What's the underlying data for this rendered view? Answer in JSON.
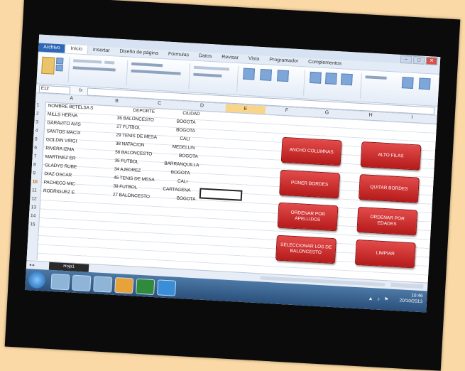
{
  "window": {
    "minimize": "–",
    "maximize": "□",
    "close": "✕"
  },
  "ribbon": {
    "tabs": [
      "Archivo",
      "Inicio",
      "Insertar",
      "Diseño de página",
      "Fórmulas",
      "Datos",
      "Revisar",
      "Vista",
      "Programador",
      "Complementos"
    ]
  },
  "formula_bar": {
    "name_box": "E12",
    "fx": "fx",
    "content": ""
  },
  "sheet": {
    "columns": [
      "A",
      "B",
      "C",
      "D",
      "E",
      "F",
      "G",
      "H",
      "I"
    ],
    "rows": [
      "1",
      "2",
      "3",
      "4",
      "5",
      "6",
      "7",
      "8",
      "9",
      "10",
      "11",
      "12",
      "13",
      "14",
      "15"
    ],
    "data": [
      [
        "NOMBRE BETELSA S",
        "DEPORTE",
        "CIUDAD"
      ],
      [
        "MILLS HERNA",
        "36 BALONCESTO",
        "BOGOTA"
      ],
      [
        "GARAVITO AVIS",
        "27 FUTBOL",
        "BOGOTA"
      ],
      [
        "SANTOS MACIX",
        "29 TENIS DE MESA",
        "CALI"
      ],
      [
        "GOLDIN VIRGI",
        "38 NATACION",
        "MEDELLIN"
      ],
      [
        "RIVERA IZMA",
        "56 BALONCESTO",
        "BOGOTA"
      ],
      [
        "MARTINEZ ER",
        "35 FUTBOL",
        "BARRANQUILLA"
      ],
      [
        "GLADYS RUBE",
        "34 AJEDREZ",
        "BOGOTA"
      ],
      [
        "DIAZ OSCAR",
        "45 TENIS DE MESA",
        "CALI"
      ],
      [
        "PACHECO MIC",
        "39 FUTBOL",
        "CARTAGENA"
      ],
      [
        "RODRIGUEZ E",
        "27 BALONCESTO",
        "BOGOTA"
      ]
    ]
  },
  "macro_buttons": {
    "ancho_columnas": "ANCHO COLUMNAS",
    "alto_filas": "ALTO FILAS",
    "poner_bordes": "PONER BORDES",
    "quitar_bordes": "QUITAR BORDES",
    "ordenar_apellidos": "ORDENAR POR APELLIDOS",
    "ordenar_edades": "ORDENAR POR EDADES",
    "seleccionar_baloncesto": "SELECCIONAR LOS DE BALONCESTO",
    "limpiar": "LIMPIAR"
  },
  "sheet_tabs": {
    "nav": "◂ ▸",
    "active": "Hoja1"
  },
  "taskbar": {
    "time": "10:46",
    "date": "20/10/2013",
    "tray": "▲ ♪ ⚑"
  },
  "colors": {
    "button_red": "#c42828",
    "selected_col": "#f8d58b"
  }
}
